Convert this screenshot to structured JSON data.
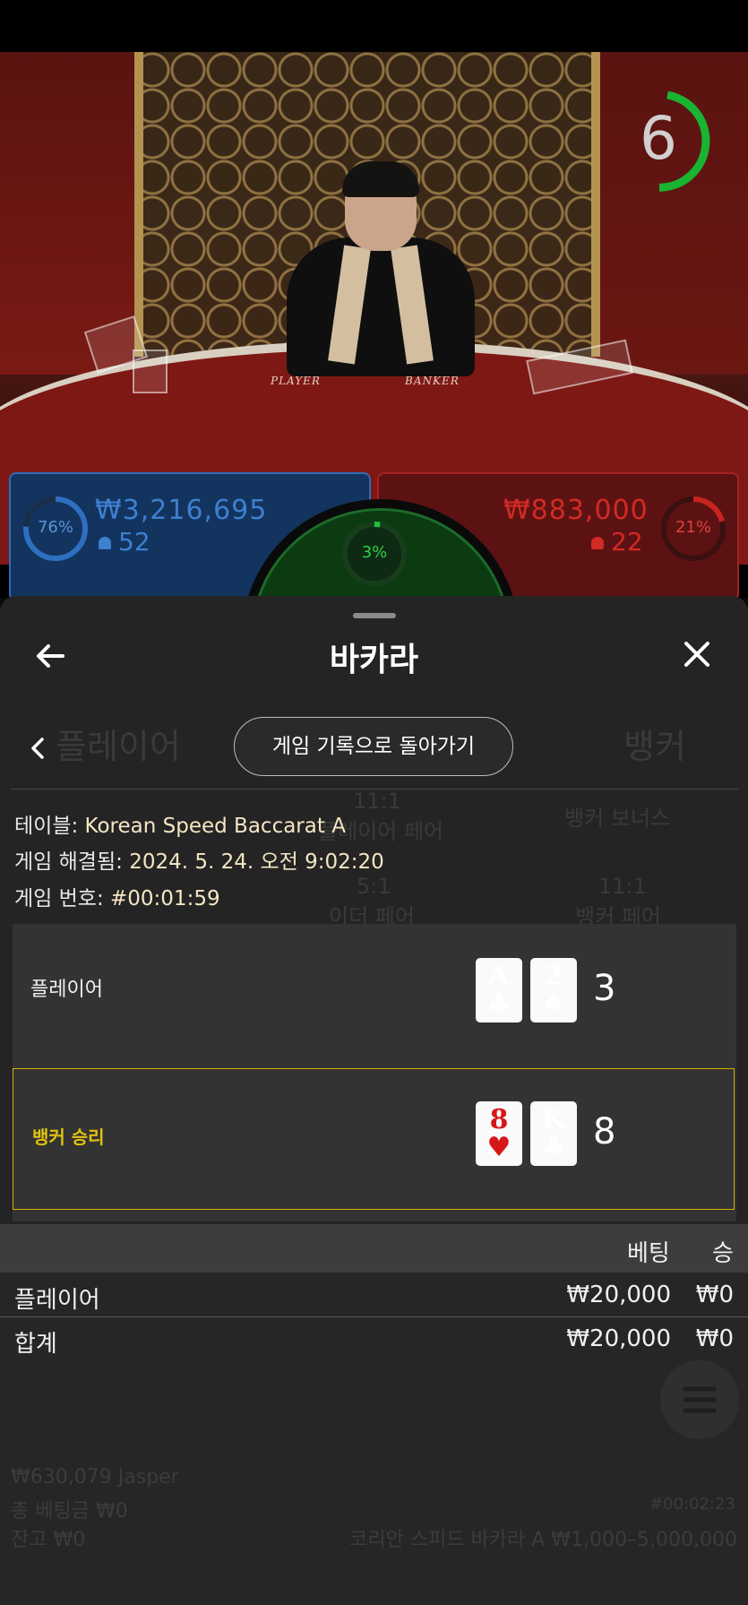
{
  "timer": {
    "seconds": "6",
    "ring_color": "#19b432"
  },
  "video": {
    "felt_player": "PLAYER",
    "felt_banker": "BANKER"
  },
  "bets": {
    "player": {
      "percent": "76%",
      "amount": "₩3,216,695",
      "count": "52",
      "color": "#2e6fc0",
      "fill": 0.76
    },
    "banker": {
      "percent": "21%",
      "amount": "₩883,000",
      "count": "22",
      "color": "#c8241f",
      "fill": 0.21
    },
    "tie": {
      "percent": "3%",
      "fill": 0.03
    }
  },
  "sheet": {
    "title": "바카라",
    "history_button": "게임 기록으로 돌아가기",
    "info": {
      "table_label": "테이블:",
      "table_value": "Korean Speed Baccarat A",
      "resolved_label": "게임 해결됨:",
      "resolved_value": "2024. 5. 24. 오전 9:02:20",
      "number_label": "게임 번호:",
      "number_value": "#00:01:59"
    },
    "results": {
      "player": {
        "label": "플레이어",
        "cards": [
          {
            "rank": "A",
            "suit": "♣",
            "red": false
          },
          {
            "rank": "2",
            "suit": "♠",
            "red": false
          }
        ],
        "score": "3"
      },
      "banker": {
        "label": "뱅커 승리",
        "cards": [
          {
            "rank": "8",
            "suit": "♥",
            "red": true
          },
          {
            "rank": "K",
            "suit": "♣",
            "red": false
          }
        ],
        "score": "8"
      }
    },
    "bet_table": {
      "col_bet": "베팅",
      "col_win": "승",
      "rows": [
        {
          "name": "플레이어",
          "bet": "₩20,000",
          "win": "₩0"
        },
        {
          "name": "합계",
          "bet": "₩20,000",
          "win": "₩0"
        }
      ]
    }
  },
  "background_ghost": {
    "player_tab": "플레이어",
    "banker_tab": "뱅커",
    "player_pair_odds": "11:1",
    "player_pair": "플레이어 페어",
    "banker_bonus": "뱅커 보너스",
    "either_pair_odds": "5:1",
    "either_pair": "이더 페어",
    "banker_pair_odds": "11:1",
    "banker_pair": "뱅커 페어",
    "balance_line": "₩630,079 Jasper",
    "total_bet": "총 베팅금 ₩0",
    "remaining": "잔고 ₩0",
    "table_limits": "코리안 스피드 바카라 A ₩1,000–5,000,000",
    "game_id": "#00:02:23"
  }
}
